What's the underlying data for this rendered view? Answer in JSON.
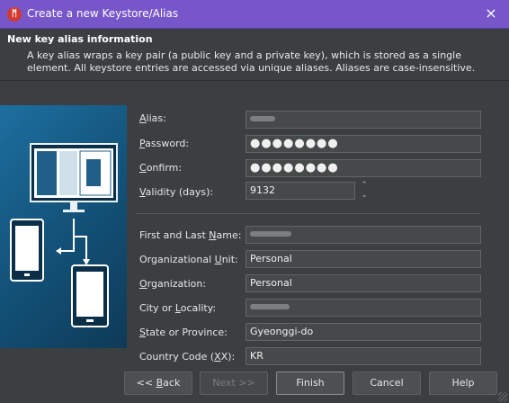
{
  "window": {
    "title": "Create a new Keystore/Alias",
    "app_icon": "jetbrains-ide-icon",
    "close_icon": "×"
  },
  "header": {
    "title": "New key alias information",
    "description": "A key alias wraps a key pair (a public key and a private key), which is stored as a single element. All keystore entries are accessed via unique aliases. Aliases are case-insensitive."
  },
  "form": {
    "alias_label_prefix": "",
    "alias_label_mn": "A",
    "alias_label_rest": "lias:",
    "password_label_mn": "P",
    "password_label_rest": "assword:",
    "confirm_label_mn": "C",
    "confirm_label_rest": "onfirm:",
    "validity_label_mn": "V",
    "validity_label_rest": "alidity (days):",
    "validity_value": "9132",
    "password_value": "●●●●●●●●",
    "confirm_value": "●●●●●●●●",
    "name_label_a": "First and Last ",
    "name_label_mn": "N",
    "name_label_b": "ame:",
    "unit_label_a": "Organizational ",
    "unit_label_mn": "U",
    "unit_label_b": "nit:",
    "unit_value": "Personal",
    "org_label_mn": "O",
    "org_label_b": "rganization:",
    "org_value": "Personal",
    "city_label_a": "City or ",
    "city_label_mn": "L",
    "city_label_b": "ocality:",
    "state_label_mn": "S",
    "state_label_b": "tate or Province:",
    "state_value": "Gyeonggi-do",
    "country_label_a": "Country Code (",
    "country_label_mn": "X",
    "country_label_b": "X):",
    "country_value": "KR"
  },
  "buttons": {
    "back": "<< ",
    "back_mn": "B",
    "back_rest": "ack",
    "next": "Next >>",
    "finish": "Finish",
    "cancel": "Cancel",
    "help": "Help"
  },
  "colors": {
    "titlebar": "#7756c9",
    "background": "#3c3f41",
    "field": "#45494a"
  }
}
